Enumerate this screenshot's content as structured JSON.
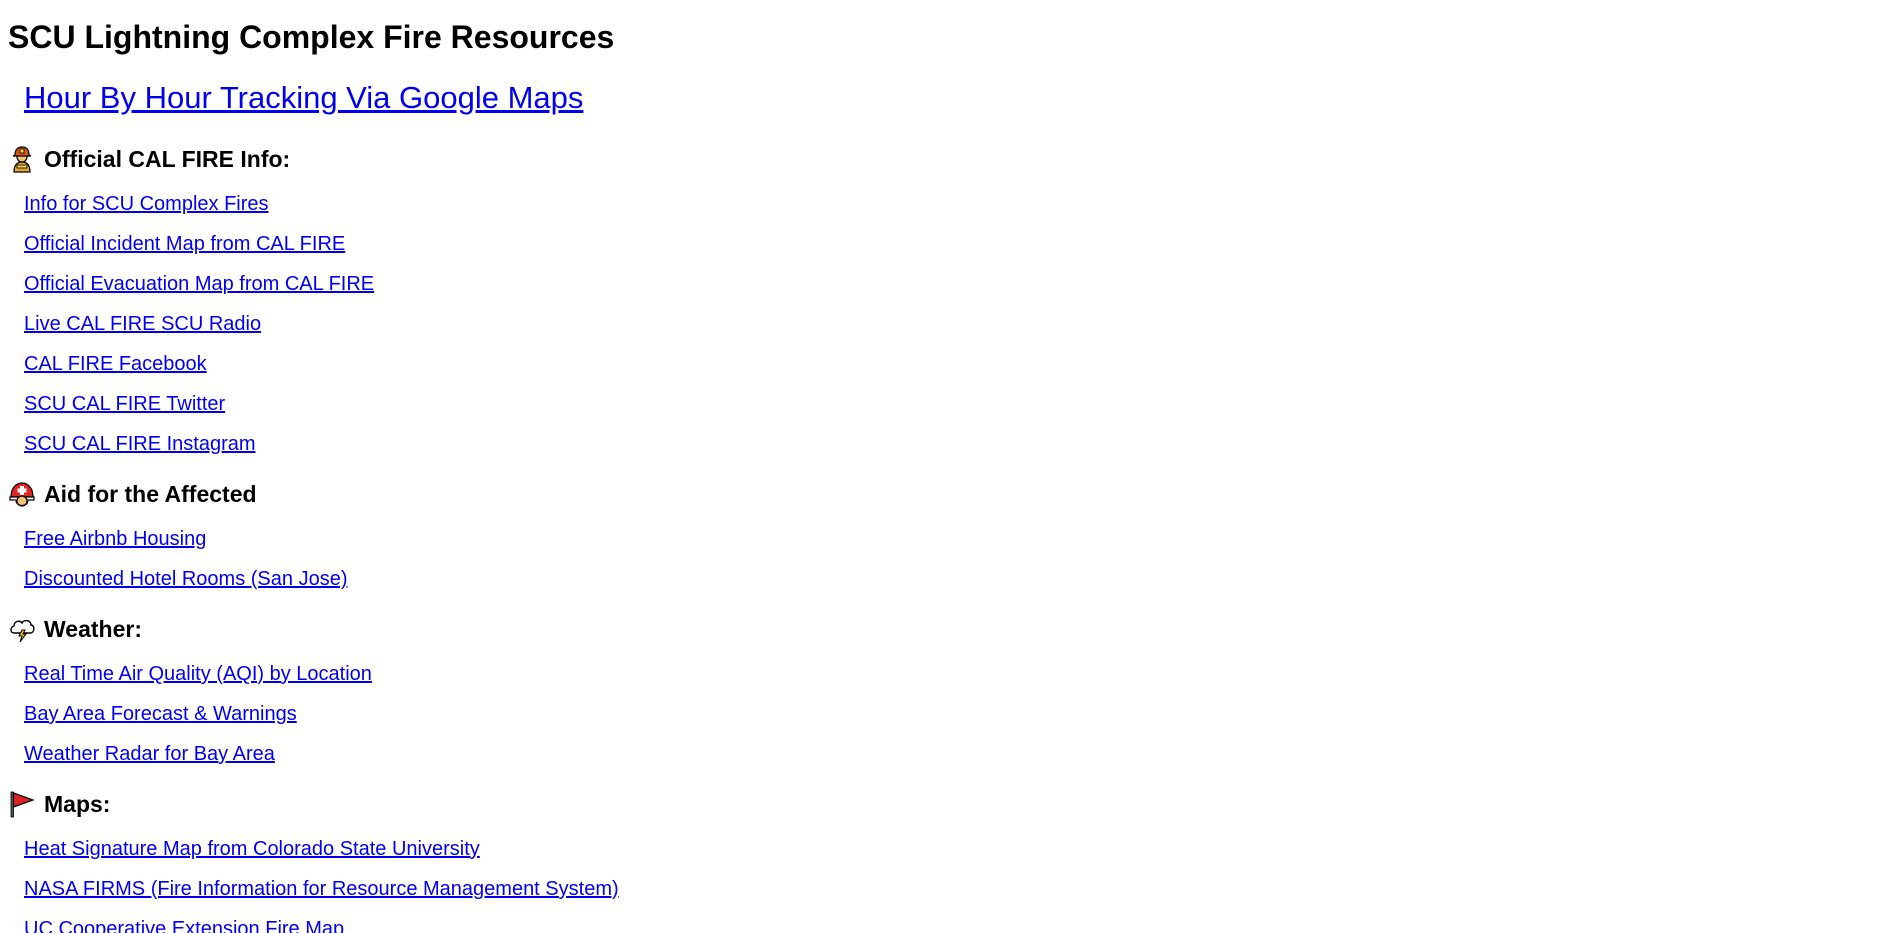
{
  "page": {
    "title": "SCU Lightning Complex Fire Resources",
    "main_link": "Hour By Hour Tracking Via Google Maps"
  },
  "sections": [
    {
      "heading": "Official CAL FIRE Info:",
      "icon": "firefighter-icon",
      "links": [
        "Info for SCU Complex Fires",
        "Official Incident Map from CAL FIRE",
        "Official Evacuation Map from CAL FIRE",
        "Live CAL FIRE SCU Radio",
        "CAL FIRE Facebook",
        "SCU CAL FIRE Twitter",
        "SCU CAL FIRE Instagram"
      ]
    },
    {
      "heading": "Aid for the Affected",
      "icon": "rescue-helmet-icon",
      "links": [
        "Free Airbnb Housing",
        "Discounted Hotel Rooms (San Jose)"
      ]
    },
    {
      "heading": "Weather:",
      "icon": "cloud-lightning-icon",
      "links": [
        "Real Time Air Quality (AQI) by Location",
        "Bay Area Forecast & Warnings",
        "Weather Radar for Bay Area"
      ]
    },
    {
      "heading": "Maps:",
      "icon": "red-flag-icon",
      "links": [
        "Heat Signature Map from Colorado State University",
        "NASA FIRMS (Fire Information for Resource Management System)",
        "UC Cooperative Extension Fire Map"
      ]
    }
  ],
  "colors": {
    "link": "#0000ee",
    "text": "#000000",
    "background": "#ffffff"
  }
}
